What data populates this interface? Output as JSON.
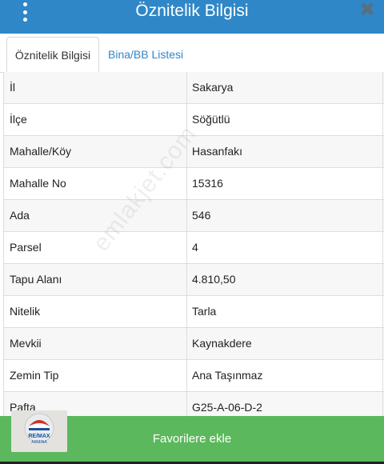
{
  "header": {
    "title": "Öznitelik Bilgisi",
    "menu_icon": "vertical-dots-icon",
    "close_icon": "close-icon",
    "close_glyph": "✖",
    "color": "#2f87c8"
  },
  "tabs": [
    {
      "label": "Öznitelik Bilgisi",
      "active": true
    },
    {
      "label": "Bina/BB Listesi",
      "active": false
    }
  ],
  "attributes": [
    {
      "label": "İl",
      "value": "Sakarya"
    },
    {
      "label": "İlçe",
      "value": "Söğütlü"
    },
    {
      "label": "Mahalle/Köy",
      "value": "Hasanfakı"
    },
    {
      "label": "Mahalle No",
      "value": "15316"
    },
    {
      "label": "Ada",
      "value": "546"
    },
    {
      "label": "Parsel",
      "value": "4"
    },
    {
      "label": "Tapu Alanı",
      "value": "4.810,50"
    },
    {
      "label": "Nitelik",
      "value": "Tarla"
    },
    {
      "label": "Mevkii",
      "value": "Kaynakdere"
    },
    {
      "label": "Zemin Tip",
      "value": "Ana Taşınmaz"
    },
    {
      "label": "Pafta",
      "value": "G25-A-06-D-2"
    }
  ],
  "footer": {
    "button_label": "Favorilere ekle",
    "color": "#5cb85c"
  },
  "watermark": {
    "text": "emlakjet.com"
  },
  "logo": {
    "brand": "RE/MAX",
    "name": "ARMINA"
  }
}
